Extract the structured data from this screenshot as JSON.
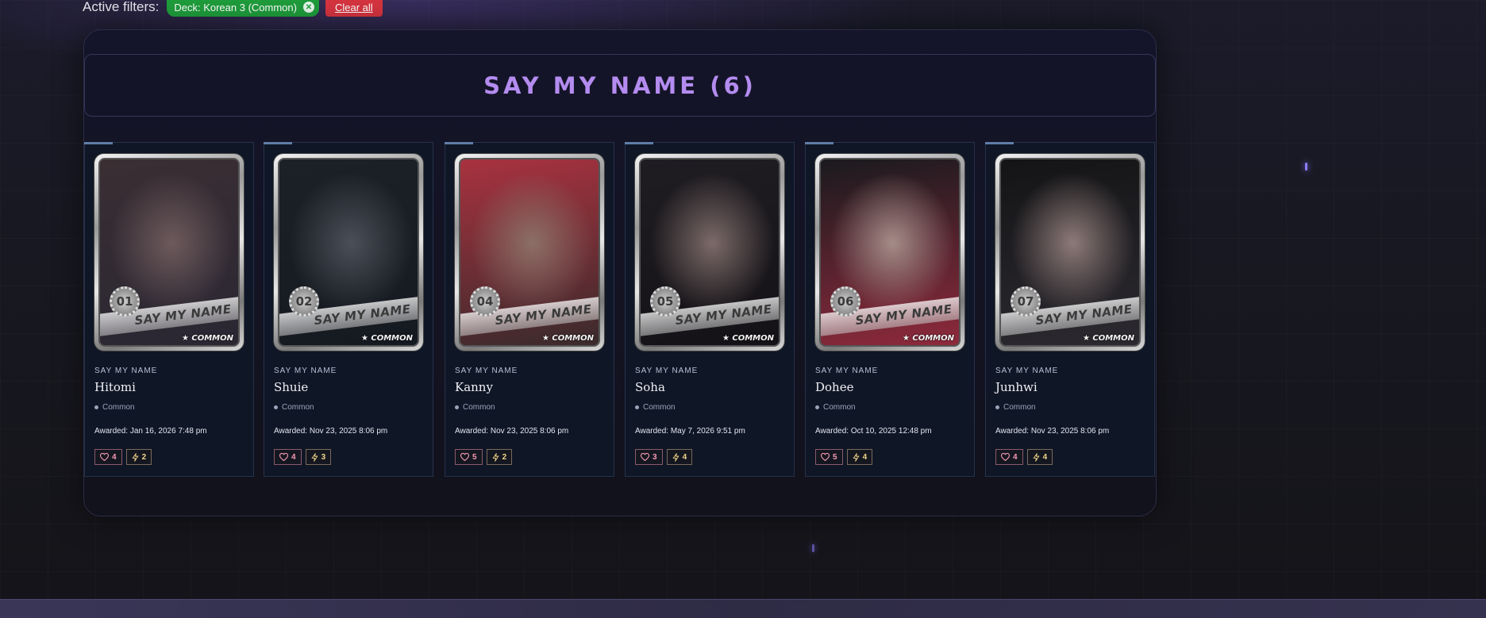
{
  "filters": {
    "label": "Active filters:",
    "chips": [
      {
        "label": "Deck: Korean 3 (Common)",
        "remove_icon": "close-icon"
      }
    ],
    "clear_label": "Clear all"
  },
  "section": {
    "title": "SAY MY NAME (6)"
  },
  "colors": {
    "accent": "#b48cf0",
    "filter_chip": "#1f9d3c",
    "clear_button": "#d63440",
    "panel_bg": "#12121c",
    "card_bg": "#0f1626"
  },
  "cards": [
    {
      "set": "SAY MY NAME",
      "name": "Hitomi",
      "number": "01",
      "band": "SAY MY NAME",
      "rarity_mark": "★ COMMON",
      "rarity": "Common",
      "awarded": "Awarded: Jan 16, 2026 7:48 pm",
      "likes": "4",
      "power": "2",
      "tone": [
        "#3a2e33",
        "#6d5a5c",
        "#2a2733"
      ]
    },
    {
      "set": "SAY MY NAME",
      "name": "Shuie",
      "number": "02",
      "band": "SAY MY NAME",
      "rarity_mark": "★ COMMON",
      "rarity": "Common",
      "awarded": "Awarded: Nov 23, 2025 8:06 pm",
      "likes": "4",
      "power": "3",
      "tone": [
        "#1c2128",
        "#4a5058",
        "#151920"
      ]
    },
    {
      "set": "SAY MY NAME",
      "name": "Kanny",
      "number": "04",
      "band": "SAY MY NAME",
      "rarity_mark": "★ COMMON",
      "rarity": "Common",
      "awarded": "Awarded: Nov 23, 2025 8:06 pm",
      "likes": "5",
      "power": "2",
      "tone": [
        "#a8323f",
        "#8c6f67",
        "#3a2a2c"
      ]
    },
    {
      "set": "SAY MY NAME",
      "name": "Soha",
      "number": "05",
      "band": "SAY MY NAME",
      "rarity_mark": "★ COMMON",
      "rarity": "Common",
      "awarded": "Awarded: May 7, 2026 9:51 pm",
      "likes": "3",
      "power": "4",
      "tone": [
        "#1f1d22",
        "#7c6a68",
        "#141216"
      ]
    },
    {
      "set": "SAY MY NAME",
      "name": "Dohee",
      "number": "06",
      "band": "SAY MY NAME",
      "rarity_mark": "★ COMMON",
      "rarity": "Common",
      "awarded": "Awarded: Oct 10, 2025 12:48 pm",
      "likes": "5",
      "power": "4",
      "tone": [
        "#1a1a1e",
        "#a58c88",
        "#8e2a3c"
      ]
    },
    {
      "set": "SAY MY NAME",
      "name": "Junhwi",
      "number": "07",
      "band": "SAY MY NAME",
      "rarity_mark": "★ COMMON",
      "rarity": "Common",
      "awarded": "Awarded: Nov 23, 2025 8:06 pm",
      "likes": "4",
      "power": "4",
      "tone": [
        "#141416",
        "#8d7a78",
        "#2c2a30"
      ]
    }
  ]
}
